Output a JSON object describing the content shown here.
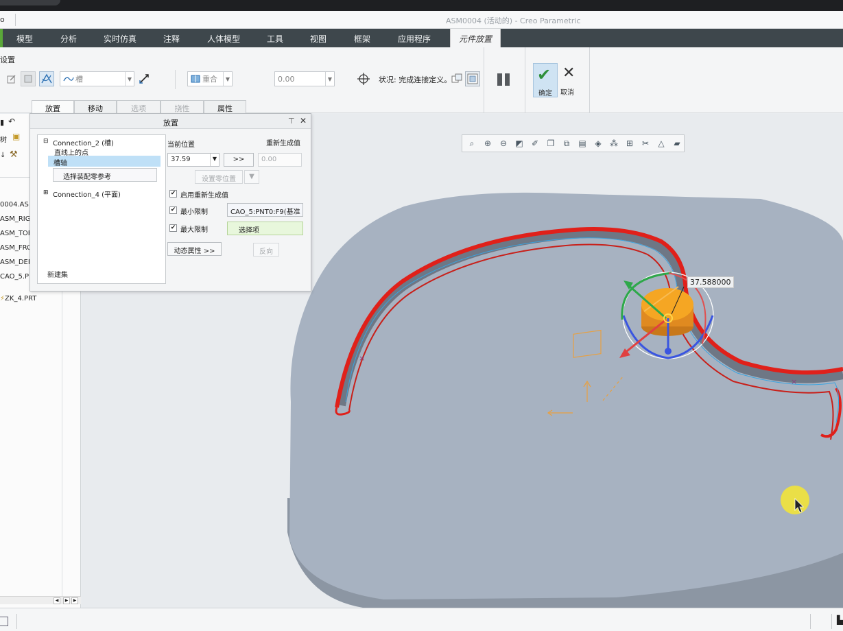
{
  "app": {
    "logo_text": "o",
    "window_title": "ASM0004 (活动的) - Creo Parametric"
  },
  "ribbon_tabs": [
    {
      "label": "模型"
    },
    {
      "label": "分析"
    },
    {
      "label": "实时仿真"
    },
    {
      "label": "注释"
    },
    {
      "label": "人体模型"
    },
    {
      "label": "工具"
    },
    {
      "label": "视图"
    },
    {
      "label": "框架"
    },
    {
      "label": "应用程序"
    },
    {
      "label": "元件放置",
      "active": true
    }
  ],
  "ribbon": {
    "group_label": "设置",
    "connection_type": "槽",
    "constraint_type": "重合",
    "offset_value": "0.00",
    "status_text": "状况: 完成连接定义。",
    "ok_label": "确定",
    "cancel_label": "取消"
  },
  "sub_tabs": [
    {
      "label": "放置",
      "state": "active"
    },
    {
      "label": "移动",
      "state": "normal"
    },
    {
      "label": "选项",
      "state": "disabled"
    },
    {
      "label": "挠性",
      "state": "disabled"
    },
    {
      "label": "属性",
      "state": "normal"
    }
  ],
  "model_tree": {
    "items": [
      "0004.AS",
      "ASM_RIG",
      "ASM_TOF",
      "ASM_FRC",
      "ASM_DEF",
      "CAO_5.PF",
      "ZK_4.PRT"
    ]
  },
  "placement_dialog": {
    "title": "放置",
    "connections": [
      {
        "name": "Connection_2 (槽)",
        "children": [
          "直线上的点",
          "槽轴"
        ],
        "selected_child": "槽轴",
        "reference_label": "选择装配零参考"
      },
      {
        "name": "Connection_4 (平面)"
      }
    ],
    "new_set_label": "新建集",
    "current_position_label": "当前位置",
    "regen_value_label": "重新生成值",
    "current_position_value": "37.59",
    "regen_value": "0.00",
    "copy_button": ">>",
    "set_zero_label": "设置零位置",
    "enable_regen_label": "启用重新生成值",
    "min_limit_label": "最小限制",
    "min_limit_ref": "CAO_5:PNT0:F9(基准",
    "max_limit_label": "最大限制",
    "max_limit_ref": "选择项",
    "dynamic_props_label": "动态属性 >>",
    "flip_label": "反向",
    "enable_regen_checked": true,
    "min_limit_checked": true,
    "max_limit_checked": true
  },
  "viewport": {
    "dimension_value": "37.588000"
  },
  "colors": {
    "ribbon_dark": "#3e474c",
    "accent_green": "#5aa839",
    "part_face": "#a7b2c1",
    "slot_red": "#e0201a",
    "component_orange": "#f29a1a",
    "selection_blue": "#bfe0f7"
  }
}
